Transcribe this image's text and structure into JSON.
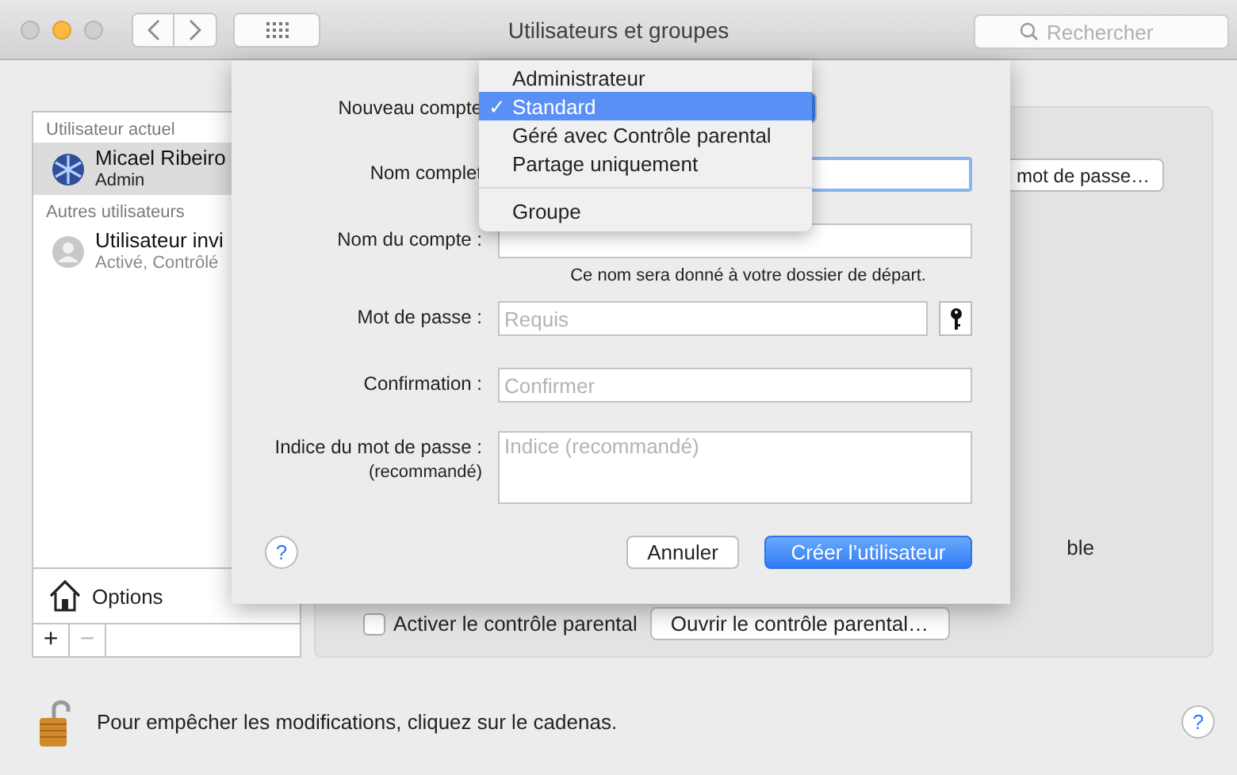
{
  "window": {
    "title": "Utilisateurs et groupes",
    "search": {
      "placeholder": "Rechercher"
    }
  },
  "sidebar": {
    "sections": [
      {
        "heading": "Utilisateur actuel",
        "users": [
          {
            "name": "Micael Ribeiro",
            "detail": "Admin",
            "kind": "admin",
            "selected": true
          }
        ]
      },
      {
        "heading": "Autres utilisateurs",
        "users": [
          {
            "name": "Utilisateur invi",
            "detail": "Activé, Contrôlé",
            "kind": "guest",
            "selected": false
          }
        ]
      }
    ],
    "options": "Options",
    "add": "+",
    "remove": "−"
  },
  "panel": {
    "password_button": "mot de passe…",
    "cut_text": "ble",
    "parental_checkbox": {
      "label": "Activer le contrôle parental",
      "checked": false
    },
    "parental_button": "Ouvrir le contrôle parental…"
  },
  "footer": {
    "lock_text": "Pour empêcher les modifications, cliquez sur le cadenas.",
    "help": "?"
  },
  "sheet": {
    "rows": [
      {
        "kind": "popup",
        "label": "Nouveau compte"
      },
      {
        "kind": "text",
        "label": "Nom complet",
        "focused": true
      },
      {
        "kind": "text",
        "label": "Nom du compte :",
        "focused": false,
        "note": "Ce nom sera donné à votre dossier de départ."
      },
      {
        "kind": "password",
        "label": "Mot de passe :",
        "placeholder": "Requis",
        "focused": false
      },
      {
        "kind": "text",
        "label": "Confirmation :",
        "placeholder": "Confirmer",
        "focused": false
      },
      {
        "kind": "area",
        "label": "Indice du mot de passe :",
        "sublabel": "(recommandé)",
        "placeholder": "Indice (recommandé)"
      }
    ],
    "help": "?",
    "cancel": "Annuler",
    "create": "Créer l’utilisateur"
  },
  "menu": {
    "sections": [
      {
        "items": [
          {
            "label": "Administrateur",
            "selected": false
          },
          {
            "label": "Standard",
            "selected": true
          },
          {
            "label": "Géré avec Contrôle parental",
            "selected": false
          },
          {
            "label": "Partage uniquement",
            "selected": false
          }
        ]
      },
      {
        "items": [
          {
            "label": "Groupe",
            "selected": false
          }
        ]
      }
    ],
    "check": "✓"
  }
}
